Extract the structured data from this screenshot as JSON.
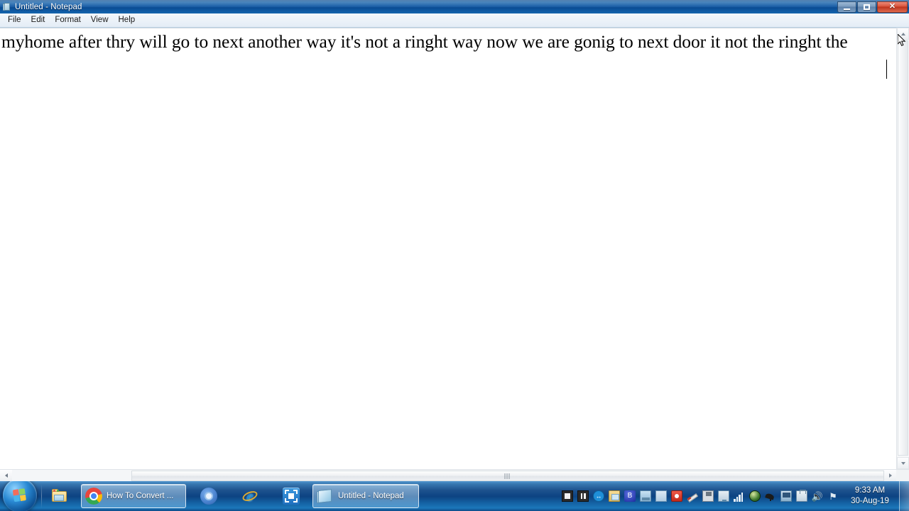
{
  "window": {
    "title": "Untitled - Notepad",
    "icon": "notepad-document-icon",
    "controls": {
      "minimize_label": "–",
      "maximize_label": "❐",
      "close_label": "✕"
    }
  },
  "menubar": {
    "items": [
      {
        "label": "File"
      },
      {
        "label": "Edit"
      },
      {
        "label": "Format"
      },
      {
        "label": "View"
      },
      {
        "label": "Help"
      }
    ]
  },
  "editor": {
    "text": "myhome after thry will go to next another way it's not a ringht way now we are gonig to next door it  not the ringht the",
    "caret_visible": true
  },
  "scrollbars": {
    "vertical": {
      "up_arrow": "▲",
      "down_arrow": "▼"
    },
    "horizontal": {
      "left_arrow": "◀",
      "right_arrow": "▶"
    }
  },
  "taskbar": {
    "start": {
      "name": "start-orb"
    },
    "buttons": [
      {
        "name": "windows-explorer",
        "icon": "folder-explorer-icon",
        "label": "",
        "state": "pinned"
      },
      {
        "name": "chrome-how-to-convert",
        "icon": "chrome-icon",
        "label": "How To Convert ...",
        "state": "active"
      },
      {
        "name": "chromium-browser",
        "icon": "chromium-icon",
        "label": "",
        "state": "pinned"
      },
      {
        "name": "internet-explorer",
        "icon": "internet-explorer-icon",
        "label": "",
        "state": "pinned"
      },
      {
        "name": "screen-capture",
        "icon": "screen-capture-icon",
        "label": "",
        "state": "pinned"
      },
      {
        "name": "notepad",
        "icon": "notepad-icon",
        "label": "Untitled - Notepad",
        "state": "active"
      }
    ],
    "tray": [
      {
        "name": "stop-icon"
      },
      {
        "name": "pause-icon"
      },
      {
        "name": "sync-arrows-icon"
      },
      {
        "name": "folder-share-icon"
      },
      {
        "name": "bluetooth-icon"
      },
      {
        "name": "network-share-icon"
      },
      {
        "name": "disc-icon"
      },
      {
        "name": "record-icon"
      },
      {
        "name": "pen-tool-icon"
      },
      {
        "name": "save-icon"
      },
      {
        "name": "monitor-icon"
      },
      {
        "name": "signal-bars-icon"
      },
      {
        "name": "globe-icon"
      },
      {
        "name": "satellite-icon"
      },
      {
        "name": "remote-screen-icon"
      },
      {
        "name": "power-plug-icon"
      },
      {
        "name": "volume-icon",
        "glyph": "🔊"
      },
      {
        "name": "action-center-flag-icon",
        "glyph": "⚑"
      }
    ],
    "clock": {
      "time": "9:33 AM",
      "date": "30-Aug-19"
    },
    "show_desktop": {
      "name": "show-desktop-button"
    }
  }
}
